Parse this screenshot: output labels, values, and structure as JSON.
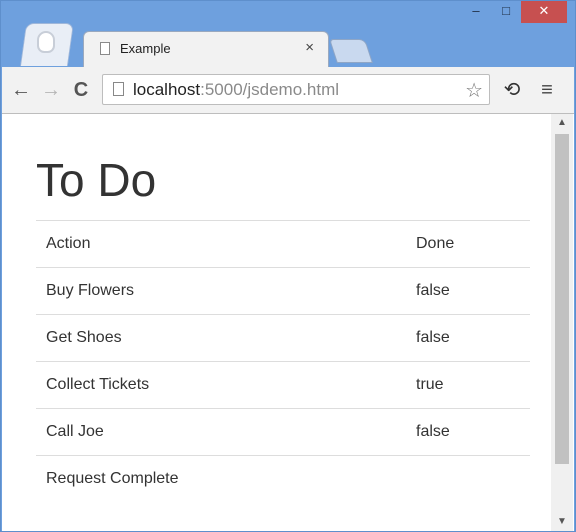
{
  "browser": {
    "tab_title": "Example",
    "tab_close": "×",
    "window_controls": {
      "minimize": "–",
      "maximize": "□",
      "close": "✕"
    },
    "toolbar": {
      "back": "←",
      "forward": "→",
      "reload": "C",
      "extension": "⟲",
      "menu": "≡"
    },
    "omnibox": {
      "host": "localhost",
      "path": ":5000/jsdemo.html",
      "star": "☆"
    }
  },
  "page": {
    "title": "To Do",
    "table": {
      "headers": [
        "Action",
        "Done"
      ],
      "rows": [
        {
          "action": "Buy Flowers",
          "done": "false"
        },
        {
          "action": "Get Shoes",
          "done": "false"
        },
        {
          "action": "Collect Tickets",
          "done": "true"
        },
        {
          "action": "Call Joe",
          "done": "false"
        }
      ],
      "footer": "Request Complete"
    }
  },
  "scrollbar": {
    "up": "▲",
    "down": "▼"
  }
}
